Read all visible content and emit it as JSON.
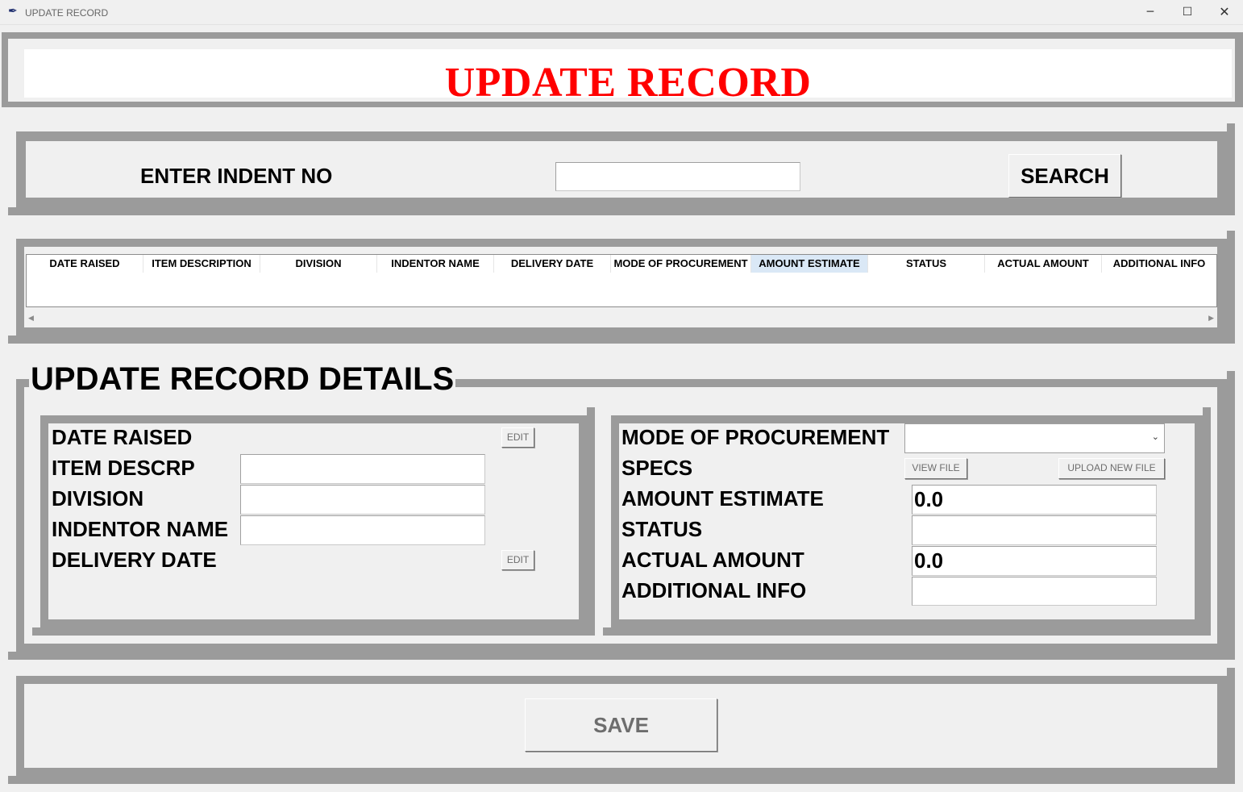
{
  "window": {
    "title": "UPDATE RECORD"
  },
  "header": {
    "title": "UPDATE RECORD"
  },
  "search": {
    "label": "ENTER INDENT NO",
    "value": "",
    "button": "SEARCH"
  },
  "table": {
    "columns": [
      "DATE RAISED",
      "ITEM DESCRIPTION",
      "DIVISION",
      "INDENTOR NAME",
      "DELIVERY DATE",
      "MODE OF PROCUREMENT",
      "AMOUNT ESTIMATE",
      "STATUS",
      "ACTUAL AMOUNT",
      "ADDITIONAL INFO"
    ],
    "selected_column": "AMOUNT ESTIMATE",
    "rows": []
  },
  "details": {
    "title": "UPDATE RECORD DETAILS",
    "left": {
      "date_raised": "DATE RAISED",
      "item_descrp": "ITEM DESCRP",
      "division": "DIVISION",
      "indentor_name": "INDENTOR NAME",
      "delivery_date": "DELIVERY DATE",
      "edit_label": "EDIT",
      "item_descrp_value": "",
      "division_value": "",
      "indentor_name_value": ""
    },
    "right": {
      "mode_of_procurement": "MODE OF PROCUREMENT",
      "specs": "SPECS",
      "amount_estimate": "AMOUNT ESTIMATE",
      "status": "STATUS",
      "actual_amount": "ACTUAL AMOUNT",
      "additional_info": "ADDITIONAL INFO",
      "view_file": "VIEW FILE",
      "upload_new_file": "UPLOAD NEW FILE",
      "mode_value": "",
      "amount_estimate_value": "0.0",
      "status_value": "",
      "actual_amount_value": "0.0",
      "additional_info_value": ""
    }
  },
  "footer": {
    "save": "SAVE"
  },
  "colors": {
    "title_red": "#ff0000",
    "frame_gray": "#9b9b9b",
    "background": "#f0f0f0"
  }
}
